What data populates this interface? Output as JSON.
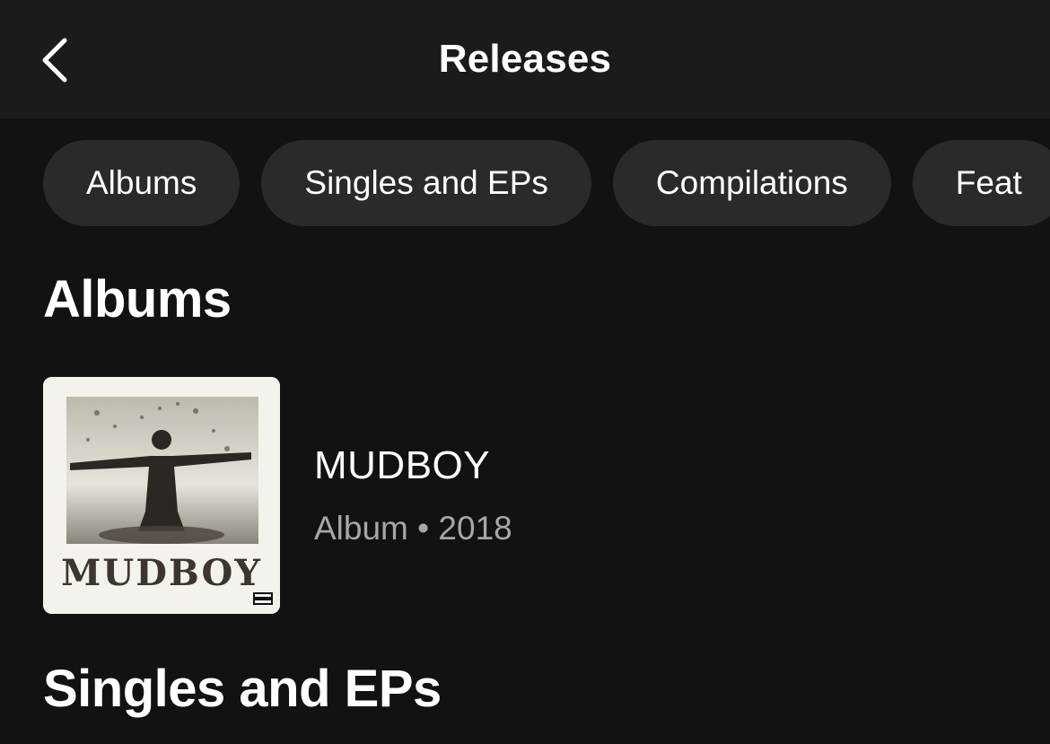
{
  "header": {
    "title": "Releases",
    "back_icon": "chevron-left-icon"
  },
  "chips": [
    {
      "label": "Albums"
    },
    {
      "label": "Singles and EPs"
    },
    {
      "label": "Compilations"
    },
    {
      "label": "Feat"
    }
  ],
  "sections": {
    "albums_title": "Albums",
    "singles_title": "Singles and EPs"
  },
  "albums": [
    {
      "title": "MUDBOY",
      "type": "Album",
      "separator": "•",
      "year": "2018",
      "cover_text": "MUDBOY"
    }
  ],
  "colors": {
    "background": "#121212",
    "header": "#1b1b1b",
    "chip": "#2a2a2a",
    "text_primary": "#ffffff",
    "text_secondary": "#a7a7a7"
  }
}
